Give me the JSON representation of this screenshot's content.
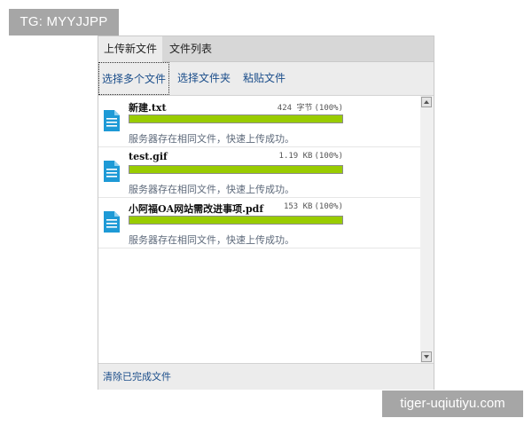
{
  "watermarks": {
    "top_left": "TG: MYYJJPP",
    "bottom_right": "tiger-uqiutiyu.com"
  },
  "tabs": [
    {
      "label": "上传新文件",
      "active": true
    },
    {
      "label": "文件列表",
      "active": false
    }
  ],
  "toolbar": {
    "select_multiple_label": "选择多个文件",
    "select_folder_label": "选择文件夹",
    "paste_label": "粘贴文件"
  },
  "files": [
    {
      "name": "新建.txt",
      "size": "424 字节",
      "percent_label": "(100%)",
      "progress": 1.0,
      "status": "服务器存在相同文件，快速上传成功。",
      "icon": "text-file-icon"
    },
    {
      "name": "test.gif",
      "size": "1.19 KB",
      "percent_label": "(100%)",
      "progress": 1.0,
      "status": "服务器存在相同文件，快速上传成功。",
      "icon": "text-file-icon"
    },
    {
      "name": "小阿福OA网站需改进事项.pdf",
      "size": "153 KB",
      "percent_label": "(100%)",
      "progress": 1.0,
      "status": "服务器存在相同文件，快速上传成功。",
      "icon": "text-file-icon"
    }
  ],
  "footer": {
    "clear_label": "清除已完成文件"
  },
  "colors": {
    "progress_fill": "#99cc00",
    "link": "#1a4d8a",
    "icon_blue": "#1e9ad6"
  }
}
